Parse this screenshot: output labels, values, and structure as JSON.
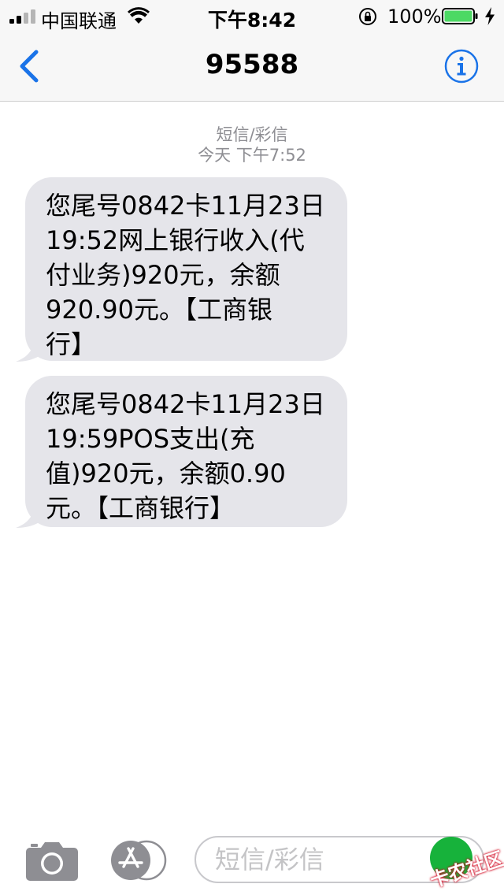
{
  "status_bar": {
    "carrier": "中国联通",
    "time": "下午8:42",
    "battery_percent": "100%"
  },
  "header": {
    "title": "95588",
    "back_icon": "chevron-left-icon",
    "info_icon": "info-icon"
  },
  "conversation": {
    "message_type": "短信/彩信",
    "timestamp": "今天 下午7:52",
    "messages": [
      {
        "text": "您尾号0842卡11月23日\n19:52网上银行收入(代\n付业务)920元，余额\n920.90元。【工商银\n行】"
      },
      {
        "text": "您尾号0842卡11月23日\n19:59POS支出(充\n值)920元，余额0.90\n元。【工商银行】"
      }
    ]
  },
  "compose": {
    "placeholder": "短信/彩信",
    "camera_icon": "camera-icon",
    "appstore_icon": "app-store-icon"
  },
  "watermark": {
    "text": "卡农社区"
  },
  "colors": {
    "accent": "#1a73e8",
    "bubble": "#e5e5ea",
    "battery": "#4cd964",
    "meta_text": "#8e8e93"
  }
}
